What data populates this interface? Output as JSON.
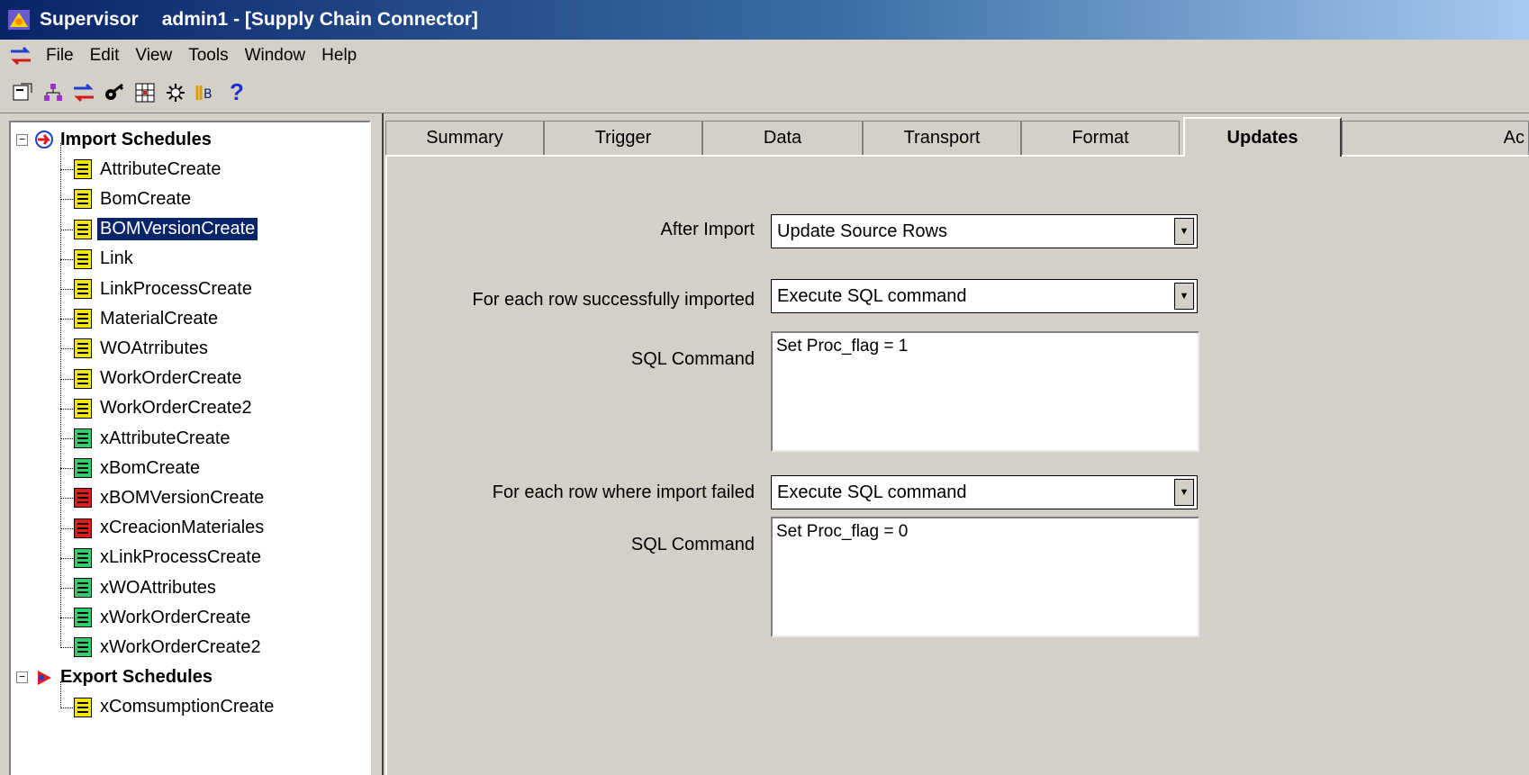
{
  "window": {
    "app_name": "Supervisor",
    "title": "admin1 - [Supply Chain Connector]"
  },
  "menu": {
    "items": [
      "File",
      "Edit",
      "View",
      "Tools",
      "Window",
      "Help"
    ]
  },
  "toolbar": {
    "icons": [
      "properties-icon",
      "hierarchy-icon",
      "connector-icon",
      "key-icon",
      "grid-icon",
      "settings-icon",
      "schedule-icon",
      "help-icon"
    ],
    "help_glyph": "?"
  },
  "tree": {
    "import_group": "Import Schedules",
    "import_items": [
      {
        "label": "AttributeCreate",
        "color": "yellow"
      },
      {
        "label": "BomCreate",
        "color": "yellow"
      },
      {
        "label": "BOMVersionCreate",
        "color": "yellow",
        "selected": true
      },
      {
        "label": "Link",
        "color": "yellow"
      },
      {
        "label": "LinkProcessCreate",
        "color": "yellow"
      },
      {
        "label": "MaterialCreate",
        "color": "yellow"
      },
      {
        "label": "WOAtrributes",
        "color": "yellow"
      },
      {
        "label": "WorkOrderCreate",
        "color": "yellow"
      },
      {
        "label": "WorkOrderCreate2",
        "color": "yellow"
      },
      {
        "label": "xAttributeCreate",
        "color": "green"
      },
      {
        "label": "xBomCreate",
        "color": "green"
      },
      {
        "label": "xBOMVersionCreate",
        "color": "red"
      },
      {
        "label": "xCreacionMateriales",
        "color": "red"
      },
      {
        "label": "xLinkProcessCreate",
        "color": "green"
      },
      {
        "label": "xWOAttributes",
        "color": "green"
      },
      {
        "label": "xWorkOrderCreate",
        "color": "green"
      },
      {
        "label": "xWorkOrderCreate2",
        "color": "green"
      }
    ],
    "export_group": "Export Schedules",
    "export_items": [
      {
        "label": "xComsumptionCreate",
        "color": "yellow"
      }
    ]
  },
  "tabs": [
    "Summary",
    "Trigger",
    "Data",
    "Transport",
    "Format",
    "Updates",
    "Ac"
  ],
  "active_tab": "Updates",
  "form": {
    "after_import_label": "After Import",
    "after_import_value": "Update Source Rows",
    "success_label": "For each row successfully imported",
    "success_value": "Execute SQL command",
    "sql_label_1": "SQL Command",
    "sql_value_1": "Set Proc_flag = 1",
    "failed_label": "For each row where import failed",
    "failed_value": "Execute SQL command",
    "sql_label_2": "SQL Command",
    "sql_value_2": "Set Proc_flag = 0"
  },
  "colors": {
    "titlebar_start": "#0a246a",
    "selection": "#0a246a",
    "doc_yellow": "#f5e800",
    "doc_green": "#2fd06a",
    "doc_red": "#e21a1a",
    "chrome": "#d4d0c8"
  }
}
